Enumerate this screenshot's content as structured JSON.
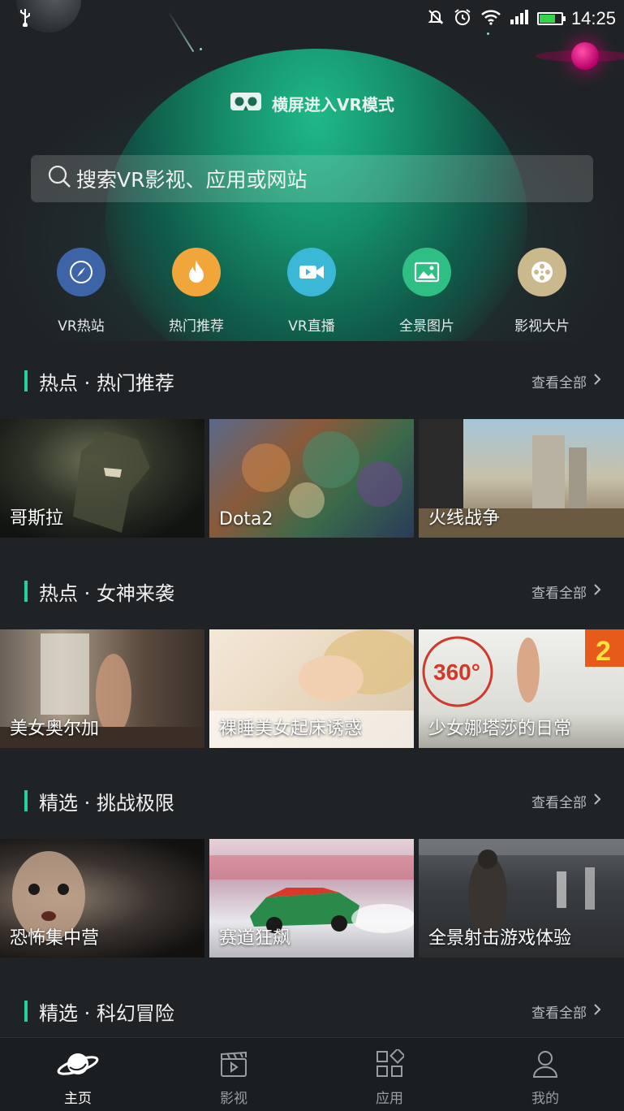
{
  "status_bar": {
    "time": "14:25",
    "battery_level": 0.75
  },
  "hero": {
    "vr_mode_label": "横屏进入VR模式"
  },
  "search": {
    "placeholder": "搜索VR影视、应用或网站"
  },
  "categories": [
    {
      "label": "VR热站",
      "icon": "compass-icon",
      "color": "#3e64a8"
    },
    {
      "label": "热门推荐",
      "icon": "flame-icon",
      "color": "#f0a63a"
    },
    {
      "label": "VR直播",
      "icon": "video-camera-icon",
      "color": "#3ab8d6"
    },
    {
      "label": "全景图片",
      "icon": "image-icon",
      "color": "#2fbf84"
    },
    {
      "label": "影视大片",
      "icon": "film-reel-icon",
      "color": "#c9b98c"
    }
  ],
  "sections": [
    {
      "title": "热点 · 热门推荐",
      "view_all": "查看全部",
      "items": [
        "哥斯拉",
        "Dota2",
        "火线战争"
      ]
    },
    {
      "title": "热点 · 女神来袭",
      "view_all": "查看全部",
      "items": [
        "美女奥尔加",
        "裸睡美女起床诱惑",
        "少女娜塔莎的日常"
      ]
    },
    {
      "title": "精选 · 挑战极限",
      "view_all": "查看全部",
      "items": [
        "恐怖集中营",
        "赛道狂飙",
        "全景射击游戏体验"
      ]
    },
    {
      "title": "精选 · 科幻冒险",
      "view_all": "查看全部"
    }
  ],
  "tabs": [
    {
      "label": "主页",
      "icon": "planet-icon",
      "active": true
    },
    {
      "label": "影视",
      "icon": "clapperboard-icon",
      "active": false
    },
    {
      "label": "应用",
      "icon": "apps-grid-icon",
      "active": false
    },
    {
      "label": "我的",
      "icon": "user-icon",
      "active": false
    }
  ],
  "colors": {
    "accent": "#22d39a",
    "background": "#1f2326"
  }
}
